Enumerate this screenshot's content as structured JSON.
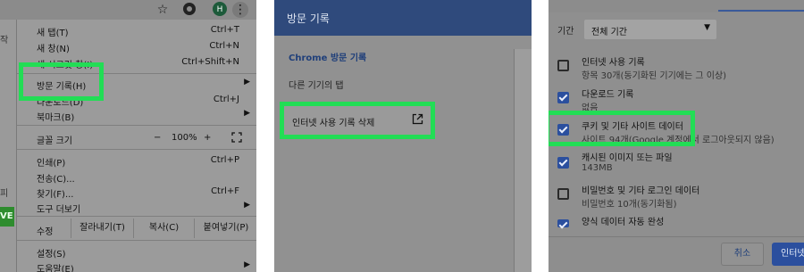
{
  "panel1": {
    "toolbar_icons": [
      "star-icon",
      "extension-icon",
      "profile-avatar",
      "kebab-menu-icon"
    ],
    "avatar_letter": "H",
    "page_edge": {
      "t1": "작",
      "t2": "피",
      "t3": "VE"
    },
    "menu": {
      "new_tab": {
        "label": "새 탭(T)",
        "shortcut": "Ctrl+T"
      },
      "new_window": {
        "label": "새 창(N)",
        "shortcut": "Ctrl+N"
      },
      "new_incognito": {
        "label": "새 시크릿 창(I)",
        "shortcut": "Ctrl+Shift+N"
      },
      "history": {
        "label": "방문 기록(H)"
      },
      "downloads": {
        "label": "다운로드(D)",
        "shortcut": "Ctrl+J"
      },
      "bookmarks": {
        "label": "북마크(B)"
      },
      "zoom": {
        "label": "글꼴 크기",
        "minus": "−",
        "value": "100%",
        "plus": "+"
      },
      "print": {
        "label": "인쇄(P)",
        "shortcut": "Ctrl+P"
      },
      "cast": {
        "label": "전송(C)..."
      },
      "find": {
        "label": "찾기(F)...",
        "shortcut": "Ctrl+F"
      },
      "more_tools": {
        "label": "도구 더보기"
      },
      "edit": {
        "label": "수정",
        "cut": "잘라내기(T)",
        "copy": "복사(C)",
        "paste": "붙여넣기(P)"
      },
      "settings": {
        "label": "설정(S)"
      },
      "help": {
        "label": "도움말(E)"
      }
    }
  },
  "panel2": {
    "header_title": "방문 기록",
    "nav": {
      "chrome_history": "Chrome 방문 기록",
      "other_devices": "다른 기기의 탭"
    },
    "clear_data": "인터넷 사용 기록 삭제"
  },
  "panel3": {
    "range_label": "기간",
    "range_value": "전체 기간",
    "options": [
      {
        "title": "인터넷 사용 기록",
        "sub": "항목 30개(동기화된 기기에는 그 이상)",
        "checked": false
      },
      {
        "title": "다운로드 기록",
        "sub": "없음",
        "checked": true
      },
      {
        "title": "쿠키 및 기타 사이트 데이터",
        "sub": "사이트 94개(Google 계정에서 로그아웃되지 않음)",
        "checked": true
      },
      {
        "title": "캐시된 이미지 또는 파일",
        "sub": "143MB",
        "checked": true
      },
      {
        "title": "비밀번호 및 기타 로그인 데이터",
        "sub": "비밀번호 10개(동기화됨)",
        "checked": false
      },
      {
        "title": "양식 데이터 자동 완성",
        "sub": "",
        "checked": true
      }
    ],
    "cancel": "취소",
    "clear": "인터넷"
  },
  "colors": {
    "highlight": "#22dd55",
    "accent": "#2b4f9e",
    "header": "#2f4a7c"
  }
}
